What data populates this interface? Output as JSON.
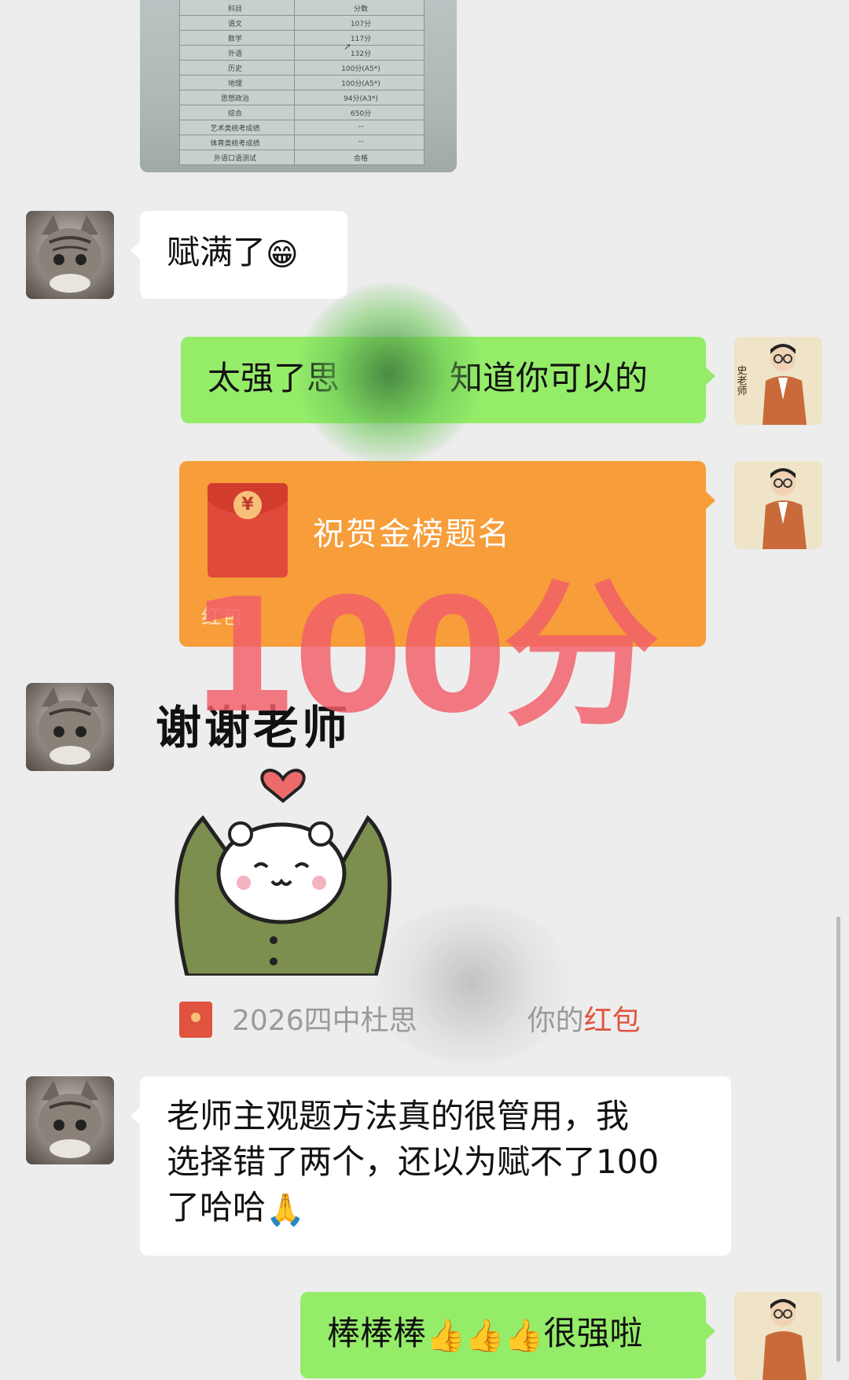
{
  "score_table": {
    "header": [
      "科目",
      "分数"
    ],
    "rows": [
      [
        "语文",
        "107分"
      ],
      [
        "数学",
        "117分"
      ],
      [
        "外语",
        "132分"
      ],
      [
        "历史",
        "100分(A5*)"
      ],
      [
        "地理",
        "100分(A5*)"
      ],
      [
        "思想政治",
        "94分(A3*)"
      ],
      [
        "综合",
        "650分"
      ],
      [
        "艺术类统考成绩",
        "--"
      ],
      [
        "体育类统考成绩",
        "--"
      ],
      [
        "外语口语测试",
        "合格"
      ]
    ]
  },
  "messages": {
    "m1_text": "赋满了",
    "m1_emoji": "😁",
    "m2_text": "太强了思",
    "m2_text_end": "知道你可以的",
    "red_packet_title": "祝贺金榜题名",
    "red_packet_footer": "红包",
    "red_packet_icon": "¥",
    "sticker_text": "谢谢老师",
    "overlay_score": "100分",
    "system_prefix": "2026四中杜思",
    "system_suffix": "你的",
    "system_link": "红包",
    "m3_line1": "老师主观题方法真的很管用，我",
    "m3_line2": "选择错了两个，还以为赋不了100",
    "m3_line3": "了哈哈",
    "m3_emoji": "🙏",
    "m4_text_a": "棒棒棒",
    "m4_emoji": "👍👍👍",
    "m4_text_b": "很强啦"
  },
  "teacher_avatar_label": "史老师",
  "colors": {
    "bg": "#ededed",
    "green_bubble": "#95ec69",
    "red_packet": "#f79d3a",
    "overlay": "#f25e6a"
  }
}
